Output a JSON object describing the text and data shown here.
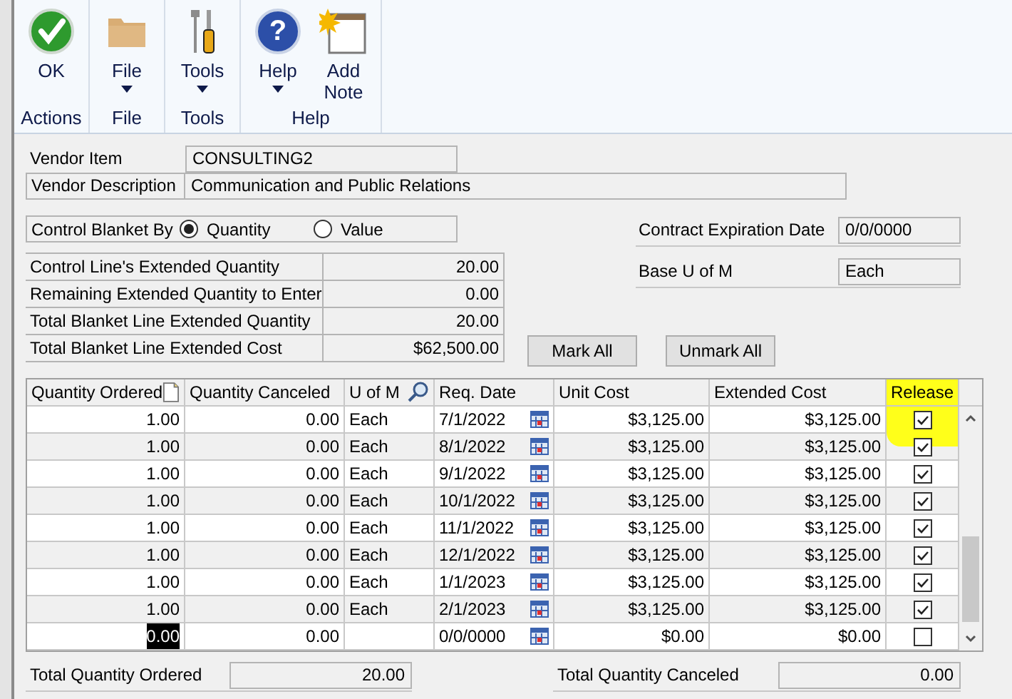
{
  "ribbon": {
    "groups": [
      {
        "label": "Actions",
        "buttons": [
          {
            "label": "OK",
            "dropdown": false
          }
        ]
      },
      {
        "label": "File",
        "buttons": [
          {
            "label": "File",
            "dropdown": true
          }
        ]
      },
      {
        "label": "Tools",
        "buttons": [
          {
            "label": "Tools",
            "dropdown": true
          }
        ]
      },
      {
        "label": "Help",
        "buttons": [
          {
            "label": "Help",
            "glyph": "?",
            "dropdown": true
          },
          {
            "label": "Add Note",
            "dropdown": false
          }
        ]
      }
    ]
  },
  "vendor_item": {
    "label": "Vendor Item",
    "value": "CONSULTING2"
  },
  "vendor_description": {
    "label": "Vendor Description",
    "value": "Communication and Public Relations"
  },
  "control_blanket_by": {
    "label": "Control Blanket By",
    "options": [
      {
        "label": "Quantity",
        "selected": true
      },
      {
        "label": "Value",
        "selected": false
      }
    ]
  },
  "contract_expiration_date": {
    "label": "Contract Expiration Date",
    "value": "0/0/0000"
  },
  "base_u_of_m": {
    "label": "Base U of M",
    "value": "Each"
  },
  "quantities": [
    {
      "label": "Control Line's Extended Quantity",
      "value": "20.00"
    },
    {
      "label": "Remaining Extended Quantity to Enter",
      "value": "0.00"
    },
    {
      "label": "Total Blanket Line Extended Quantity",
      "value": "20.00"
    },
    {
      "label": "Total Blanket Line Extended Cost",
      "value": "$62,500.00"
    }
  ],
  "buttons": [
    {
      "label": "Mark All"
    },
    {
      "label": "Unmark All"
    }
  ],
  "table": {
    "columns": [
      "Quantity Ordered",
      "Quantity Canceled",
      "U of M",
      "Req. Date",
      "Unit Cost",
      "Extended Cost",
      "Release"
    ],
    "release_highlighted": true,
    "rows": [
      {
        "quantity_ordered": "1.00",
        "quantity_canceled": "0.00",
        "u_of_m": "Each",
        "req_date": "7/1/2022",
        "unit_cost": "$3,125.00",
        "extended_cost": "$3,125.00",
        "release": true,
        "focused": false
      },
      {
        "quantity_ordered": "1.00",
        "quantity_canceled": "0.00",
        "u_of_m": "Each",
        "req_date": "8/1/2022",
        "unit_cost": "$3,125.00",
        "extended_cost": "$3,125.00",
        "release": true,
        "focused": false
      },
      {
        "quantity_ordered": "1.00",
        "quantity_canceled": "0.00",
        "u_of_m": "Each",
        "req_date": "9/1/2022",
        "unit_cost": "$3,125.00",
        "extended_cost": "$3,125.00",
        "release": true,
        "focused": false
      },
      {
        "quantity_ordered": "1.00",
        "quantity_canceled": "0.00",
        "u_of_m": "Each",
        "req_date": "10/1/2022",
        "unit_cost": "$3,125.00",
        "extended_cost": "$3,125.00",
        "release": true,
        "focused": false
      },
      {
        "quantity_ordered": "1.00",
        "quantity_canceled": "0.00",
        "u_of_m": "Each",
        "req_date": "11/1/2022",
        "unit_cost": "$3,125.00",
        "extended_cost": "$3,125.00",
        "release": true,
        "focused": false
      },
      {
        "quantity_ordered": "1.00",
        "quantity_canceled": "0.00",
        "u_of_m": "Each",
        "req_date": "12/1/2022",
        "unit_cost": "$3,125.00",
        "extended_cost": "$3,125.00",
        "release": true,
        "focused": false
      },
      {
        "quantity_ordered": "1.00",
        "quantity_canceled": "0.00",
        "u_of_m": "Each",
        "req_date": "1/1/2023",
        "unit_cost": "$3,125.00",
        "extended_cost": "$3,125.00",
        "release": true,
        "focused": false
      },
      {
        "quantity_ordered": "1.00",
        "quantity_canceled": "0.00",
        "u_of_m": "Each",
        "req_date": "2/1/2023",
        "unit_cost": "$3,125.00",
        "extended_cost": "$3,125.00",
        "release": true,
        "focused": false
      },
      {
        "quantity_ordered": "0.00",
        "quantity_canceled": "0.00",
        "req_date": "0/0/0000",
        "unit_cost": "$0.00",
        "extended_cost": "$0.00",
        "release": false,
        "focused": true
      }
    ]
  },
  "totals": [
    {
      "label": "Total Quantity Ordered",
      "value": "20.00"
    },
    {
      "label": "Total Quantity Canceled",
      "value": "0.00"
    }
  ]
}
